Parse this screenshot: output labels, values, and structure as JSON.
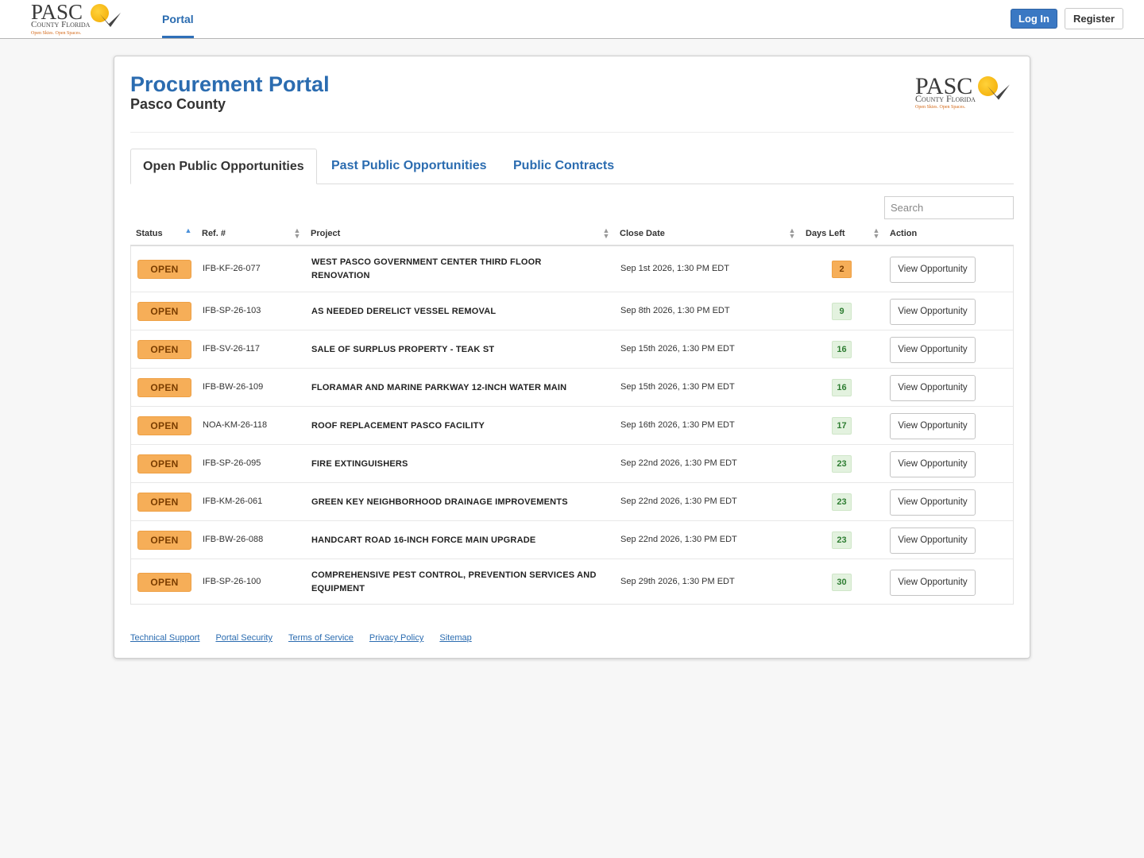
{
  "header": {
    "logo": {
      "word": "PASC",
      "county": "County Florida",
      "tagline": "Open Skies. Open Spaces."
    },
    "nav_portal": "Portal",
    "login": "Log In",
    "register": "Register"
  },
  "page": {
    "title": "Procurement Portal",
    "subtitle": "Pasco County"
  },
  "tabs": [
    {
      "label": "Open Public Opportunities",
      "active": true
    },
    {
      "label": "Past Public Opportunities",
      "active": false
    },
    {
      "label": "Public Contracts",
      "active": false
    }
  ],
  "search": {
    "placeholder": "Search",
    "value": ""
  },
  "table": {
    "columns": [
      "Status",
      "Ref. #",
      "Project",
      "Close Date",
      "Days Left",
      "Action"
    ],
    "rows": [
      {
        "status": "OPEN",
        "ref": "IFB-KF-26-077",
        "project": "WEST PASCO GOVERNMENT CENTER THIRD FLOOR RENOVATION",
        "close_date": "Sep 1st 2026, 1:30 PM EDT",
        "days_left": "2",
        "action": "View Opportunity"
      },
      {
        "status": "OPEN",
        "ref": "IFB-SP-26-103",
        "project": "AS NEEDED DERELICT VESSEL REMOVAL",
        "close_date": "Sep 8th 2026, 1:30 PM EDT",
        "days_left": "9",
        "action": "View Opportunity"
      },
      {
        "status": "OPEN",
        "ref": "IFB-SV-26-117",
        "project": "SALE OF SURPLUS PROPERTY - TEAK ST",
        "close_date": "Sep 15th 2026, 1:30 PM EDT",
        "days_left": "16",
        "action": "View Opportunity"
      },
      {
        "status": "OPEN",
        "ref": "IFB-BW-26-109",
        "project": "FLORAMAR AND MARINE PARKWAY 12-INCH WATER MAIN",
        "close_date": "Sep 15th 2026, 1:30 PM EDT",
        "days_left": "16",
        "action": "View Opportunity"
      },
      {
        "status": "OPEN",
        "ref": "NOA-KM-26-118",
        "project": "ROOF REPLACEMENT PASCO FACILITY",
        "close_date": "Sep 16th 2026, 1:30 PM EDT",
        "days_left": "17",
        "action": "View Opportunity"
      },
      {
        "status": "OPEN",
        "ref": "IFB-SP-26-095",
        "project": "FIRE EXTINGUISHERS",
        "close_date": "Sep 22nd 2026, 1:30 PM EDT",
        "days_left": "23",
        "action": "View Opportunity"
      },
      {
        "status": "OPEN",
        "ref": "IFB-KM-26-061",
        "project": "GREEN KEY NEIGHBORHOOD DRAINAGE IMPROVEMENTS",
        "close_date": "Sep 22nd 2026, 1:30 PM EDT",
        "days_left": "23",
        "action": "View Opportunity"
      },
      {
        "status": "OPEN",
        "ref": "IFB-BW-26-088",
        "project": "HANDCART ROAD 16-INCH FORCE MAIN UPGRADE",
        "close_date": "Sep 22nd 2026, 1:30 PM EDT",
        "days_left": "23",
        "action": "View Opportunity"
      },
      {
        "status": "OPEN",
        "ref": "IFB-SP-26-100",
        "project": "COMPREHENSIVE PEST CONTROL, PREVENTION SERVICES AND EQUIPMENT",
        "close_date": "Sep 29th 2026, 1:30 PM EDT",
        "days_left": "30",
        "action": "View Opportunity"
      }
    ]
  },
  "footer": {
    "links": [
      "Technical Support",
      "Portal Security",
      "Terms of Service",
      "Privacy Policy",
      "Sitemap"
    ]
  },
  "colors": {
    "accent": "#2b6cb0",
    "login_button": "#3a78c3",
    "open_badge": "#f6ae58",
    "days_warning": "#f6ae58",
    "days_ok": "#e3f2df"
  },
  "icons": [
    "pasco-county-logo",
    "sort-asc-icon",
    "sort-icon"
  ]
}
